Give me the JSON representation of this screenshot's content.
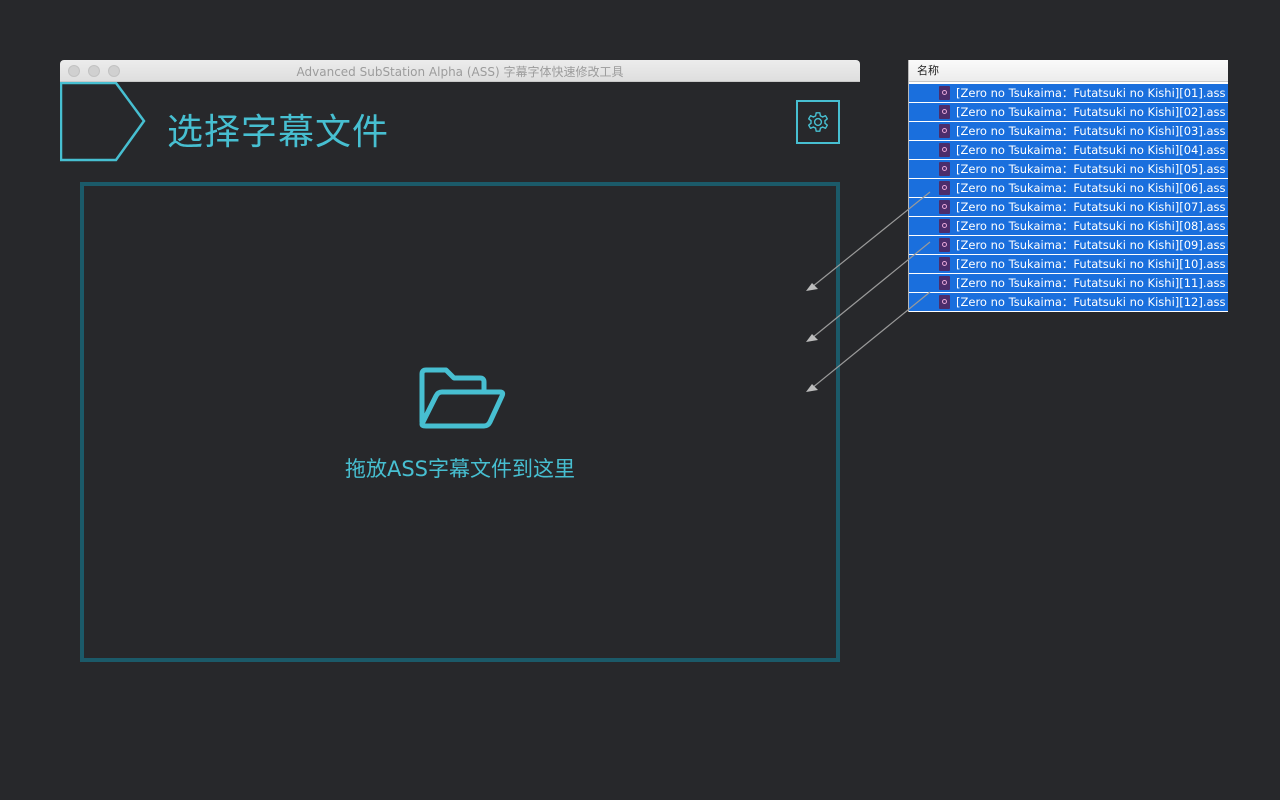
{
  "window": {
    "title": "Advanced SubStation Alpha (ASS) 字幕字体快速修改工具"
  },
  "header": {
    "title": "选择字幕文件",
    "settings_icon": "gear-icon"
  },
  "drop_zone": {
    "icon": "folder-open-icon",
    "label": "拖放ASS字幕文件到这里"
  },
  "finder": {
    "column_header": "名称",
    "files": [
      "[Zero no Tsukaima：Futatsuki no Kishi][01].ass",
      "[Zero no Tsukaima：Futatsuki no Kishi][02].ass",
      "[Zero no Tsukaima：Futatsuki no Kishi][03].ass",
      "[Zero no Tsukaima：Futatsuki no Kishi][04].ass",
      "[Zero no Tsukaima：Futatsuki no Kishi][05].ass",
      "[Zero no Tsukaima：Futatsuki no Kishi][06].ass",
      "[Zero no Tsukaima：Futatsuki no Kishi][07].ass",
      "[Zero no Tsukaima：Futatsuki no Kishi][08].ass",
      "[Zero no Tsukaima：Futatsuki no Kishi][09].ass",
      "[Zero no Tsukaima：Futatsuki no Kishi][10].ass",
      "[Zero no Tsukaima：Futatsuki no Kishi][11].ass",
      "[Zero no Tsukaima：Futatsuki no Kishi][12].ass"
    ]
  },
  "colors": {
    "accent": "#47bfd1",
    "drop_border": "#1b5a69",
    "background": "#27282b",
    "selection": "#1a6fdd"
  }
}
